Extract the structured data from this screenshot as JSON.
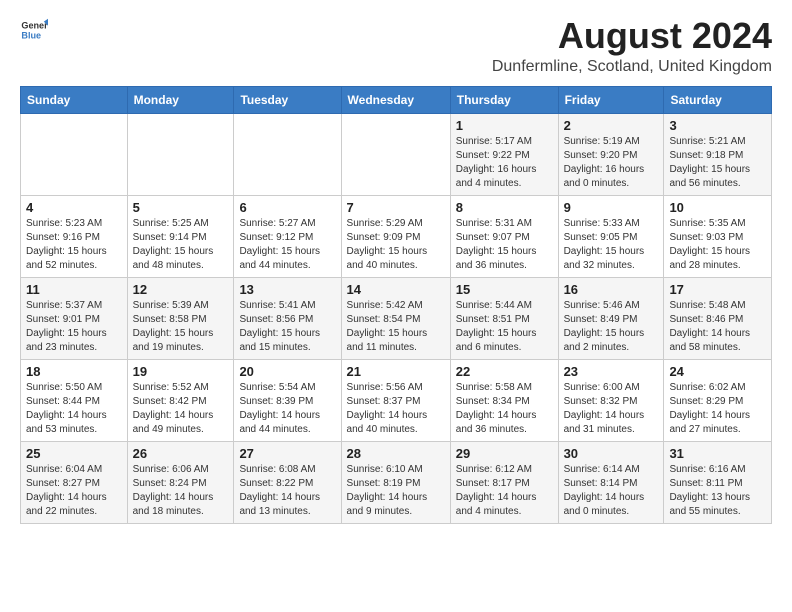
{
  "logo": {
    "general": "General",
    "blue": "Blue"
  },
  "title": "August 2024",
  "location": "Dunfermline, Scotland, United Kingdom",
  "headers": [
    "Sunday",
    "Monday",
    "Tuesday",
    "Wednesday",
    "Thursday",
    "Friday",
    "Saturday"
  ],
  "weeks": [
    [
      {
        "day": "",
        "info": ""
      },
      {
        "day": "",
        "info": ""
      },
      {
        "day": "",
        "info": ""
      },
      {
        "day": "",
        "info": ""
      },
      {
        "day": "1",
        "info": "Sunrise: 5:17 AM\nSunset: 9:22 PM\nDaylight: 16 hours\nand 4 minutes."
      },
      {
        "day": "2",
        "info": "Sunrise: 5:19 AM\nSunset: 9:20 PM\nDaylight: 16 hours\nand 0 minutes."
      },
      {
        "day": "3",
        "info": "Sunrise: 5:21 AM\nSunset: 9:18 PM\nDaylight: 15 hours\nand 56 minutes."
      }
    ],
    [
      {
        "day": "4",
        "info": "Sunrise: 5:23 AM\nSunset: 9:16 PM\nDaylight: 15 hours\nand 52 minutes."
      },
      {
        "day": "5",
        "info": "Sunrise: 5:25 AM\nSunset: 9:14 PM\nDaylight: 15 hours\nand 48 minutes."
      },
      {
        "day": "6",
        "info": "Sunrise: 5:27 AM\nSunset: 9:12 PM\nDaylight: 15 hours\nand 44 minutes."
      },
      {
        "day": "7",
        "info": "Sunrise: 5:29 AM\nSunset: 9:09 PM\nDaylight: 15 hours\nand 40 minutes."
      },
      {
        "day": "8",
        "info": "Sunrise: 5:31 AM\nSunset: 9:07 PM\nDaylight: 15 hours\nand 36 minutes."
      },
      {
        "day": "9",
        "info": "Sunrise: 5:33 AM\nSunset: 9:05 PM\nDaylight: 15 hours\nand 32 minutes."
      },
      {
        "day": "10",
        "info": "Sunrise: 5:35 AM\nSunset: 9:03 PM\nDaylight: 15 hours\nand 28 minutes."
      }
    ],
    [
      {
        "day": "11",
        "info": "Sunrise: 5:37 AM\nSunset: 9:01 PM\nDaylight: 15 hours\nand 23 minutes."
      },
      {
        "day": "12",
        "info": "Sunrise: 5:39 AM\nSunset: 8:58 PM\nDaylight: 15 hours\nand 19 minutes."
      },
      {
        "day": "13",
        "info": "Sunrise: 5:41 AM\nSunset: 8:56 PM\nDaylight: 15 hours\nand 15 minutes."
      },
      {
        "day": "14",
        "info": "Sunrise: 5:42 AM\nSunset: 8:54 PM\nDaylight: 15 hours\nand 11 minutes."
      },
      {
        "day": "15",
        "info": "Sunrise: 5:44 AM\nSunset: 8:51 PM\nDaylight: 15 hours\nand 6 minutes."
      },
      {
        "day": "16",
        "info": "Sunrise: 5:46 AM\nSunset: 8:49 PM\nDaylight: 15 hours\nand 2 minutes."
      },
      {
        "day": "17",
        "info": "Sunrise: 5:48 AM\nSunset: 8:46 PM\nDaylight: 14 hours\nand 58 minutes."
      }
    ],
    [
      {
        "day": "18",
        "info": "Sunrise: 5:50 AM\nSunset: 8:44 PM\nDaylight: 14 hours\nand 53 minutes."
      },
      {
        "day": "19",
        "info": "Sunrise: 5:52 AM\nSunset: 8:42 PM\nDaylight: 14 hours\nand 49 minutes."
      },
      {
        "day": "20",
        "info": "Sunrise: 5:54 AM\nSunset: 8:39 PM\nDaylight: 14 hours\nand 44 minutes."
      },
      {
        "day": "21",
        "info": "Sunrise: 5:56 AM\nSunset: 8:37 PM\nDaylight: 14 hours\nand 40 minutes."
      },
      {
        "day": "22",
        "info": "Sunrise: 5:58 AM\nSunset: 8:34 PM\nDaylight: 14 hours\nand 36 minutes."
      },
      {
        "day": "23",
        "info": "Sunrise: 6:00 AM\nSunset: 8:32 PM\nDaylight: 14 hours\nand 31 minutes."
      },
      {
        "day": "24",
        "info": "Sunrise: 6:02 AM\nSunset: 8:29 PM\nDaylight: 14 hours\nand 27 minutes."
      }
    ],
    [
      {
        "day": "25",
        "info": "Sunrise: 6:04 AM\nSunset: 8:27 PM\nDaylight: 14 hours\nand 22 minutes."
      },
      {
        "day": "26",
        "info": "Sunrise: 6:06 AM\nSunset: 8:24 PM\nDaylight: 14 hours\nand 18 minutes."
      },
      {
        "day": "27",
        "info": "Sunrise: 6:08 AM\nSunset: 8:22 PM\nDaylight: 14 hours\nand 13 minutes."
      },
      {
        "day": "28",
        "info": "Sunrise: 6:10 AM\nSunset: 8:19 PM\nDaylight: 14 hours\nand 9 minutes."
      },
      {
        "day": "29",
        "info": "Sunrise: 6:12 AM\nSunset: 8:17 PM\nDaylight: 14 hours\nand 4 minutes."
      },
      {
        "day": "30",
        "info": "Sunrise: 6:14 AM\nSunset: 8:14 PM\nDaylight: 14 hours\nand 0 minutes."
      },
      {
        "day": "31",
        "info": "Sunrise: 6:16 AM\nSunset: 8:11 PM\nDaylight: 13 hours\nand 55 minutes."
      }
    ]
  ]
}
